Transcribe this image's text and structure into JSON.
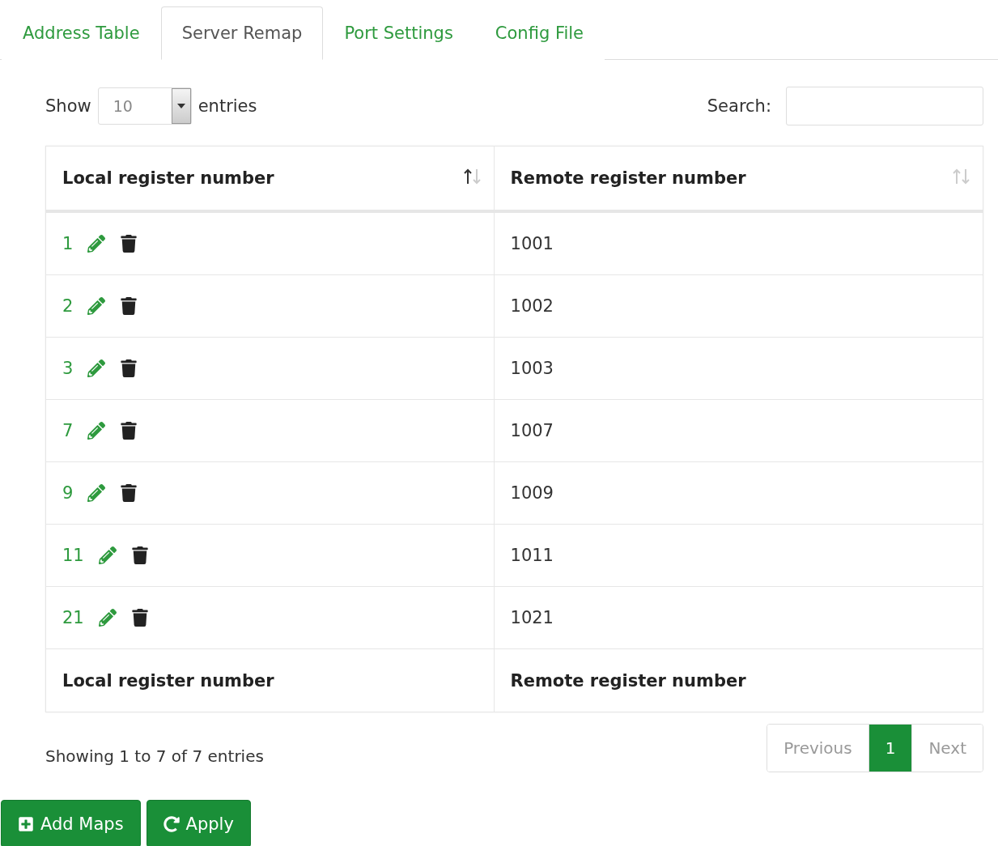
{
  "tabs": [
    {
      "label": "Address Table",
      "selected": false
    },
    {
      "label": "Server Remap",
      "selected": true
    },
    {
      "label": "Port Settings",
      "selected": false
    },
    {
      "label": "Config File",
      "selected": false
    }
  ],
  "length_menu": {
    "label_before": "Show",
    "value": "10",
    "label_after": "entries"
  },
  "search": {
    "label": "Search:"
  },
  "table": {
    "columns": [
      {
        "label": "Local register number",
        "sorted": true
      },
      {
        "label": "Remote register number",
        "sorted": false
      }
    ],
    "rows": [
      {
        "local": "1",
        "remote": "1001"
      },
      {
        "local": "2",
        "remote": "1002"
      },
      {
        "local": "3",
        "remote": "1003"
      },
      {
        "local": "7",
        "remote": "1007"
      },
      {
        "local": "9",
        "remote": "1009"
      },
      {
        "local": "11",
        "remote": "1011"
      },
      {
        "local": "21",
        "remote": "1021"
      }
    ],
    "footer": [
      "Local register number",
      "Remote register number"
    ]
  },
  "info": "Showing 1 to 7 of 7 entries",
  "pagination": [
    {
      "label": "Previous",
      "selected": false,
      "disabled": true
    },
    {
      "label": "1",
      "selected": true,
      "disabled": false
    },
    {
      "label": "Next",
      "selected": false,
      "disabled": true
    }
  ],
  "buttons": [
    {
      "label": "Add Maps",
      "kind": "add"
    },
    {
      "label": "Apply",
      "kind": "apply"
    }
  ]
}
